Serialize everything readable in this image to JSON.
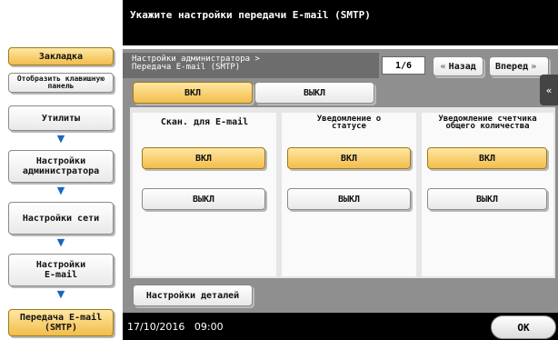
{
  "header": {
    "title": "Укажите настройки передачи E-mail (SMTP)"
  },
  "sidebar": {
    "bookmark": "Закладка",
    "keypad": "Отобразить клавишную панель",
    "path": [
      "Утилиты",
      "Настройки администратора",
      "Настройки сети",
      "Настройки E-mail",
      "Передача E-mail (SMTP)"
    ]
  },
  "breadcrumb": {
    "line1": "Настройки администратора >",
    "line2": "Передача E-mail (SMTP)"
  },
  "pager": {
    "page": "1/6",
    "back": "Назад",
    "next": "Вперед"
  },
  "toggle": {
    "on": "ВКЛ",
    "off": "ВЫКЛ",
    "selected": "ВКЛ"
  },
  "columns": [
    {
      "title": "Скан. для E-mail",
      "on": "ВКЛ",
      "off": "ВЫКЛ",
      "selected": "ВКЛ"
    },
    {
      "title": "Уведомление о статусе",
      "on": "ВКЛ",
      "off": "ВЫКЛ",
      "selected": "ВКЛ"
    },
    {
      "title": "Уведомление счетчика общего количества",
      "on": "ВКЛ",
      "off": "ВЫКЛ",
      "selected": "ВКЛ"
    }
  ],
  "details_button": "Настройки деталей",
  "footer": {
    "date": "17/10/2016",
    "time": "09:00",
    "ok": "OK"
  },
  "colors": {
    "accent": "#f2bd4c",
    "arrow": "#1667c4",
    "bar": "#000000"
  },
  "icons": {
    "back": "double-left-arrow-icon",
    "next": "double-right-arrow-icon",
    "collapse": "double-left-arrow-icon"
  }
}
